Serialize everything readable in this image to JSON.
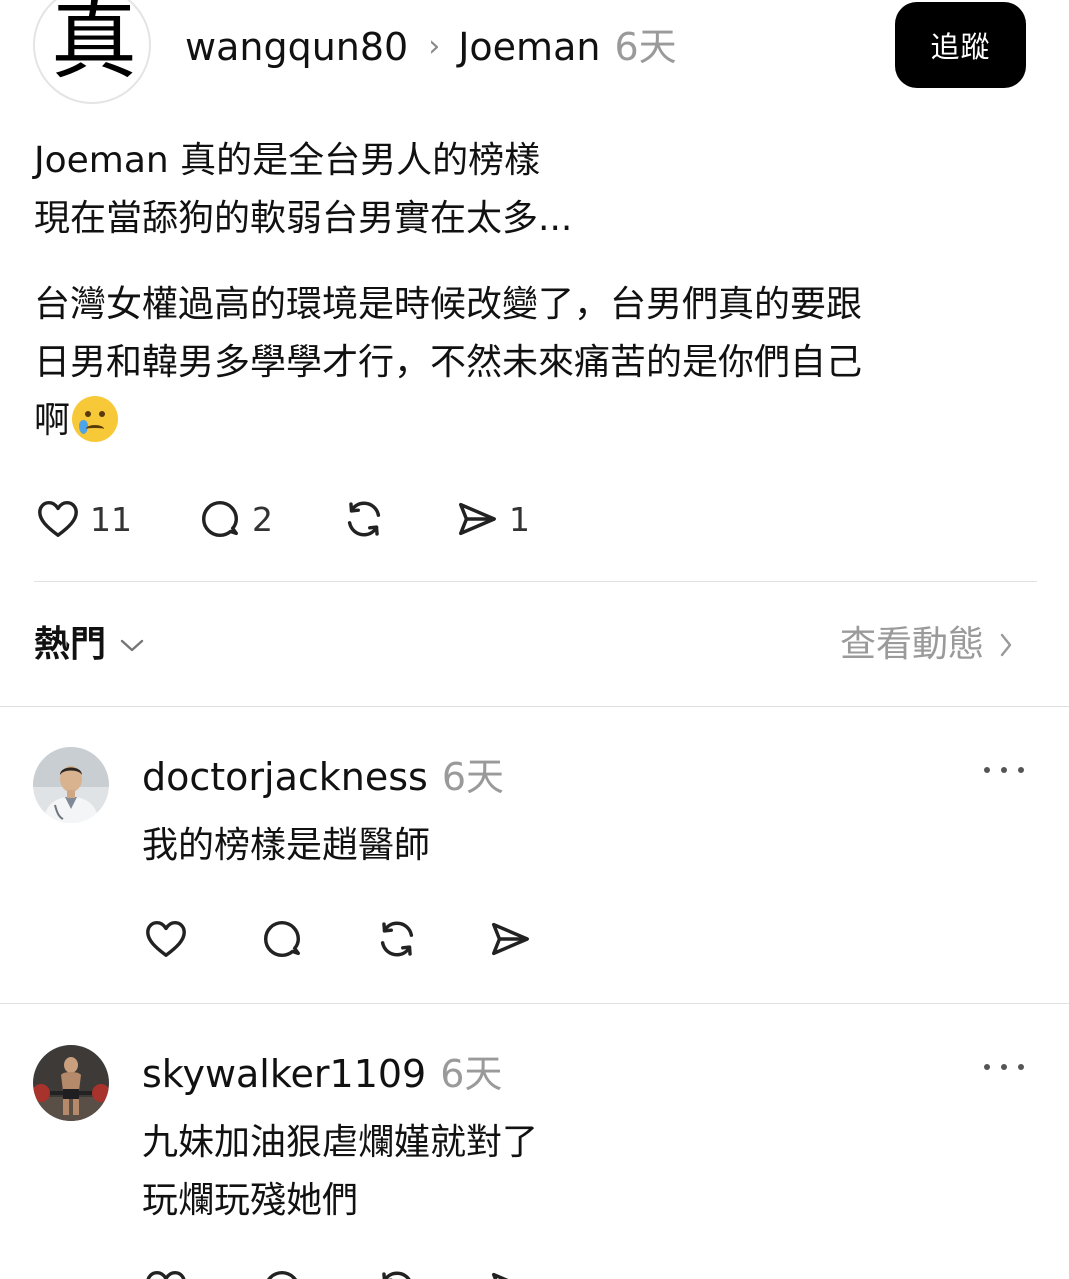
{
  "post": {
    "avatar_glyph": "真",
    "username": "wangqun80",
    "separator": "›",
    "reply_to": "Joeman",
    "time": "6天",
    "follow_label": "追蹤",
    "paragraphs": [
      {
        "lines": [
          "Joeman 真的是全台男人的榜樣",
          "現在當舔狗的軟弱台男實在太多..."
        ]
      },
      {
        "lines": [
          "台灣女權過高的環境是時候改變了，台男們真的要跟",
          "日男和韓男多學學才行，不然未來痛苦的是你們自己",
          "啊"
        ]
      }
    ],
    "emoji": "crying-face-icon",
    "actions": {
      "likes": "11",
      "comments": "2",
      "shares": "1"
    }
  },
  "sort": {
    "label": "熱門",
    "view_activity": "查看動態"
  },
  "replies": [
    {
      "username": "doctorjackness",
      "time": "6天",
      "lines": [
        "我的榜樣是趙醫師"
      ]
    },
    {
      "username": "skywalker1109",
      "time": "6天",
      "lines": [
        "九妹加油狠虐爛嫤就對了",
        "玩爛玩殘她們"
      ]
    }
  ],
  "colors": {
    "text": "#111111",
    "muted": "#9a9a9a",
    "button_bg": "#000000",
    "divider": "#e2e2e2"
  }
}
